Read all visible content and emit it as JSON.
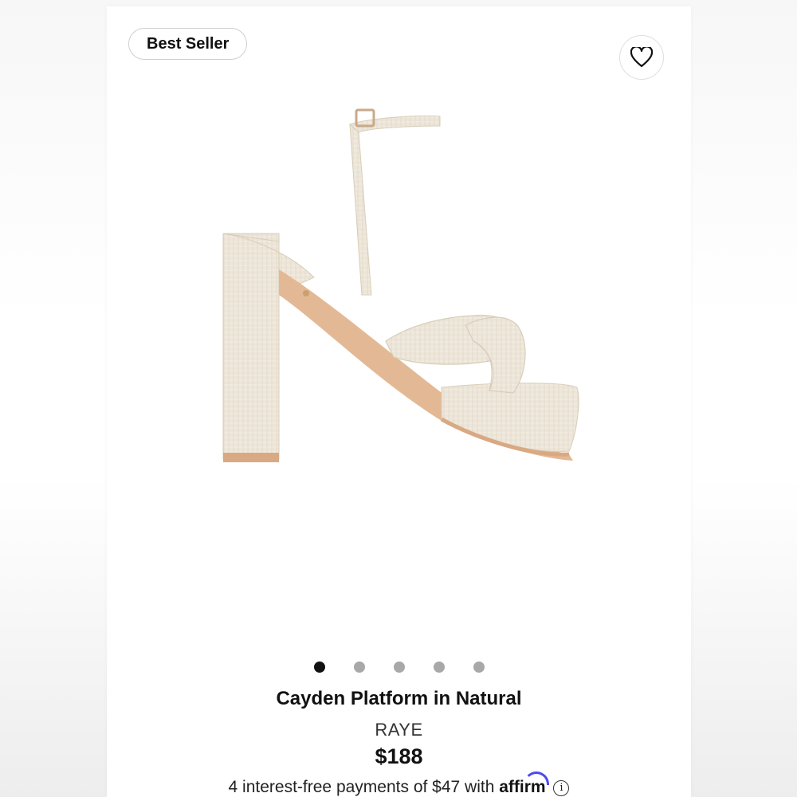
{
  "badge": {
    "label": "Best Seller"
  },
  "favorite": {
    "icon": "heart-icon"
  },
  "carousel": {
    "count": 5,
    "active_index": 0
  },
  "product": {
    "name": "Cayden Platform in Natural",
    "brand": "RAYE",
    "price": "$188"
  },
  "financing": {
    "text": "4 interest-free payments of $47 with",
    "provider": "affirm",
    "info_icon": "info-icon"
  },
  "colors": {
    "sandal": "#ece5d8",
    "sole": "#d9a983",
    "affirm_accent": "#4a4af4"
  }
}
